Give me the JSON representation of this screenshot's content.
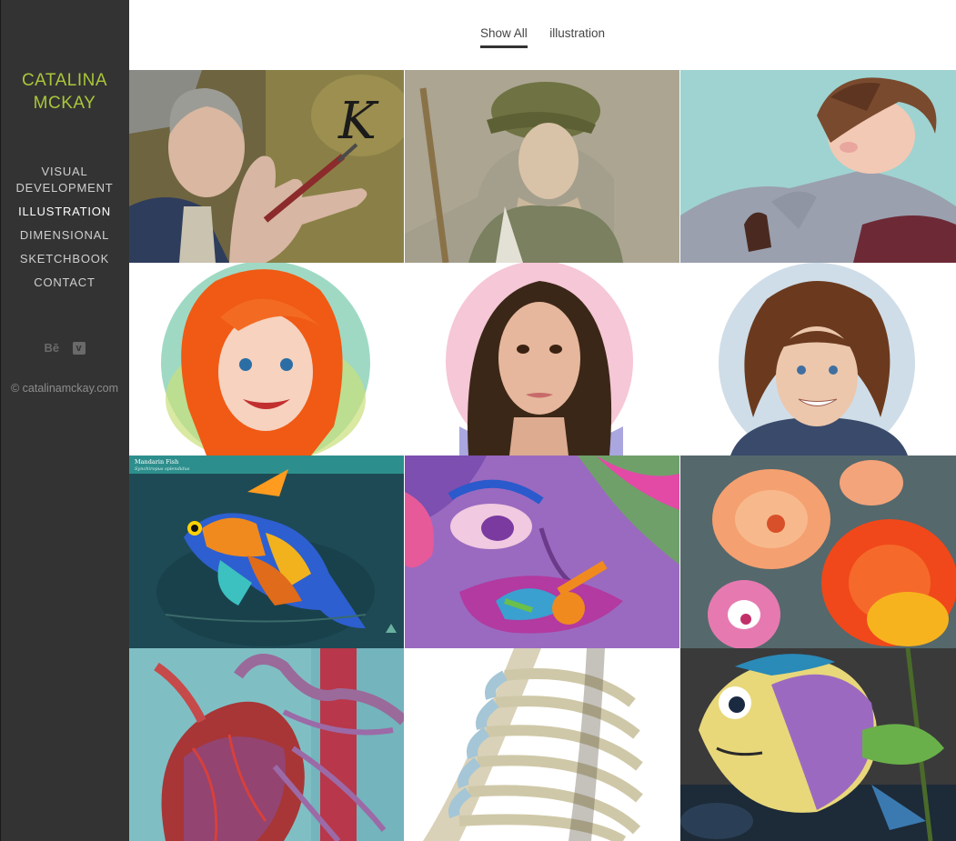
{
  "brand": {
    "name": "CATALINA\nMCKAY"
  },
  "nav": {
    "items": [
      {
        "label": "VISUAL\nDEVELOPMENT"
      },
      {
        "label": "ILLUSTRATION"
      },
      {
        "label": "DIMENSIONAL"
      },
      {
        "label": "SKETCHBOOK"
      },
      {
        "label": "CONTACT"
      }
    ]
  },
  "social": {
    "behance_icon": "Bē",
    "vimeo_icon": "v"
  },
  "footer": {
    "copyright": "© catalinamckay.com"
  },
  "filters": {
    "show_all": "Show All",
    "illustration": "illustration"
  },
  "gallery": {
    "tiles": [
      {
        "icon": "portrait-k-pen"
      },
      {
        "icon": "portrait-cap-boy"
      },
      {
        "icon": "portrait-reclining-boy"
      },
      {
        "icon": "portrait-redhead"
      },
      {
        "icon": "portrait-brunette"
      },
      {
        "icon": "portrait-curly-hair"
      },
      {
        "icon": "mandarin-fish",
        "title": "Mandarin Fish",
        "subtitle": "Synchiropus splendidus"
      },
      {
        "icon": "purple-face-flower"
      },
      {
        "icon": "orange-flowers"
      },
      {
        "icon": "anatomical-heart"
      },
      {
        "icon": "rib-cage"
      },
      {
        "icon": "painted-fish"
      }
    ]
  },
  "colors": {
    "sidebar": "#333333",
    "brand": "#a9c63a",
    "nav_text": "#cfcfcf",
    "nav_active": "#ffffff"
  }
}
